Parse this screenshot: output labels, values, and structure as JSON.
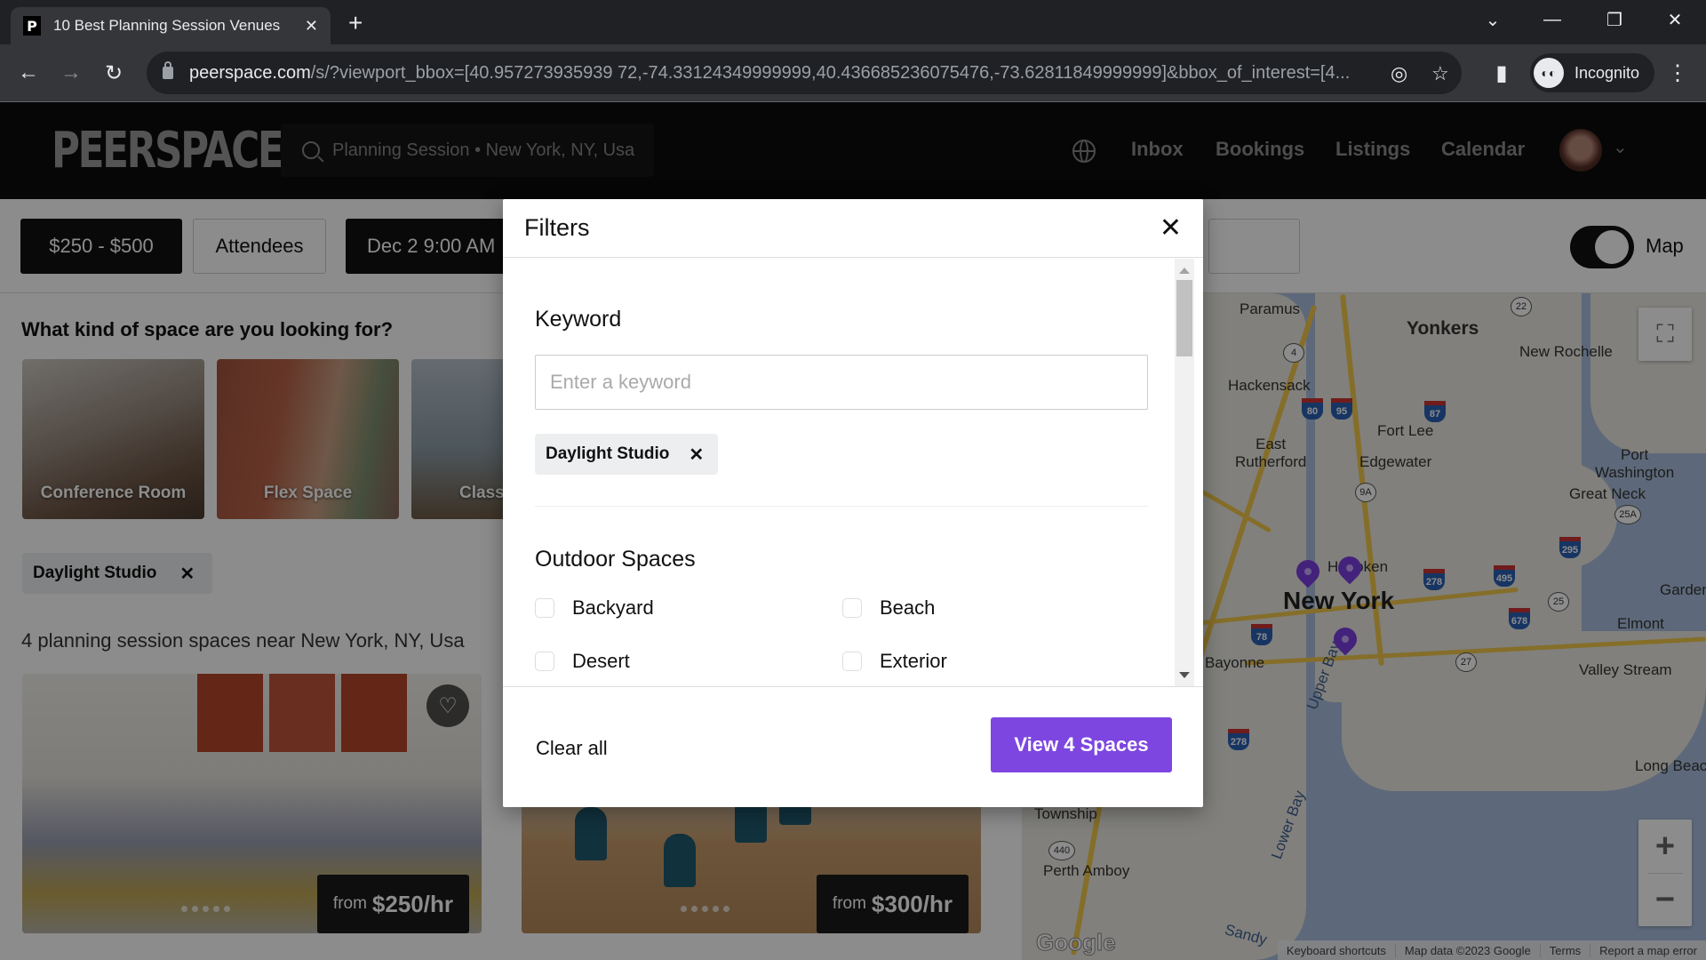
{
  "browser": {
    "tab_title": "10 Best Planning Session Venues",
    "favicon_letter": "P",
    "tab_close": "✕",
    "new_tab": "+",
    "url_host": "peerspace.com",
    "url_path": "/s/?viewport_bbox=[40.957273935939 72,-74.33124349999999,40.436685236075476,-73.62811849999999]&bbox_of_interest=[4...",
    "profile_label": "Incognito",
    "icons": {
      "back": "←",
      "forward": "→",
      "reload": "↻",
      "eye_off": "◎",
      "star": "☆",
      "sidepanel": "▮",
      "menu": "⋮",
      "tab_search": "⌄",
      "minimize": "—",
      "restore": "❐",
      "close": "✕"
    }
  },
  "header": {
    "logo": "PEERSPACE",
    "search_text": "Planning Session • New York, NY, Usa",
    "nav": [
      "Inbox",
      "Bookings",
      "Listings",
      "Calendar"
    ],
    "avatar_caret": "⌄"
  },
  "filters_bar": {
    "price": "$250 - $500",
    "attendees": "Attendees",
    "date": "Dec 2 9:00 AM",
    "map_toggle_on": true,
    "map_label": "Map"
  },
  "content": {
    "question": "What kind of space are you looking for?",
    "categories": [
      "Conference Room",
      "Flex Space",
      "Class"
    ],
    "active_keyword_chip": "Daylight Studio",
    "chip_remove": "✕",
    "results_count": "4 planning session spaces near New York, NY, Usa",
    "listings": [
      {
        "price_prefix": "from",
        "price": "$250/hr",
        "favorite_icon": "♡"
      },
      {
        "price_prefix": "from",
        "price": "$300/hr"
      }
    ]
  },
  "map": {
    "labels": {
      "paramus": "Paramus",
      "yonkers": "Yonkers",
      "new_rochelle": "New Rochelle",
      "hackensack": "Hackensack",
      "fort_lee": "Fort Lee",
      "east_rutherford": "East\nRutherford",
      "edgewater": "Edgewater",
      "port_washington": "Port\nWashington",
      "great_neck": "Great Neck",
      "hoboken": "Hoboken",
      "new_york": "New York",
      "bayonne": "Bayonne",
      "garden": "Garden",
      "elmont": "Elmont",
      "valley_stream": "Valley Stream",
      "long_beach": "Long Beac",
      "township": "Township",
      "perth_amboy": "Perth Amboy",
      "upper_bay": "Upper Bay",
      "lower_bay": "Lower Bay",
      "sandy": "Sandy"
    },
    "shields": [
      "22",
      "4",
      "9A",
      "25A",
      "25",
      "27",
      "440"
    ],
    "interstates": [
      "80",
      "95",
      "87",
      "295",
      "495",
      "278",
      "678",
      "78"
    ],
    "zoom_in": "+",
    "zoom_out": "−",
    "fullscreen": "⛶",
    "google_logo": "Google",
    "attribution": [
      "Keyboard shortcuts",
      "Map data ©2023 Google",
      "Terms",
      "Report a map error"
    ]
  },
  "modal": {
    "title": "Filters",
    "close": "✕",
    "keyword_label": "Keyword",
    "keyword_placeholder": "Enter a keyword",
    "keyword_value": "",
    "keyword_chip": "Daylight Studio",
    "keyword_chip_remove": "✕",
    "outdoor_label": "Outdoor Spaces",
    "outdoor_options": [
      {
        "label": "Backyard",
        "checked": false
      },
      {
        "label": "Beach",
        "checked": false
      },
      {
        "label": "Desert",
        "checked": false
      },
      {
        "label": "Exterior",
        "checked": false
      }
    ],
    "clear_all": "Clear all",
    "view_button": "View 4 Spaces",
    "accent_color": "#7d46e0"
  }
}
